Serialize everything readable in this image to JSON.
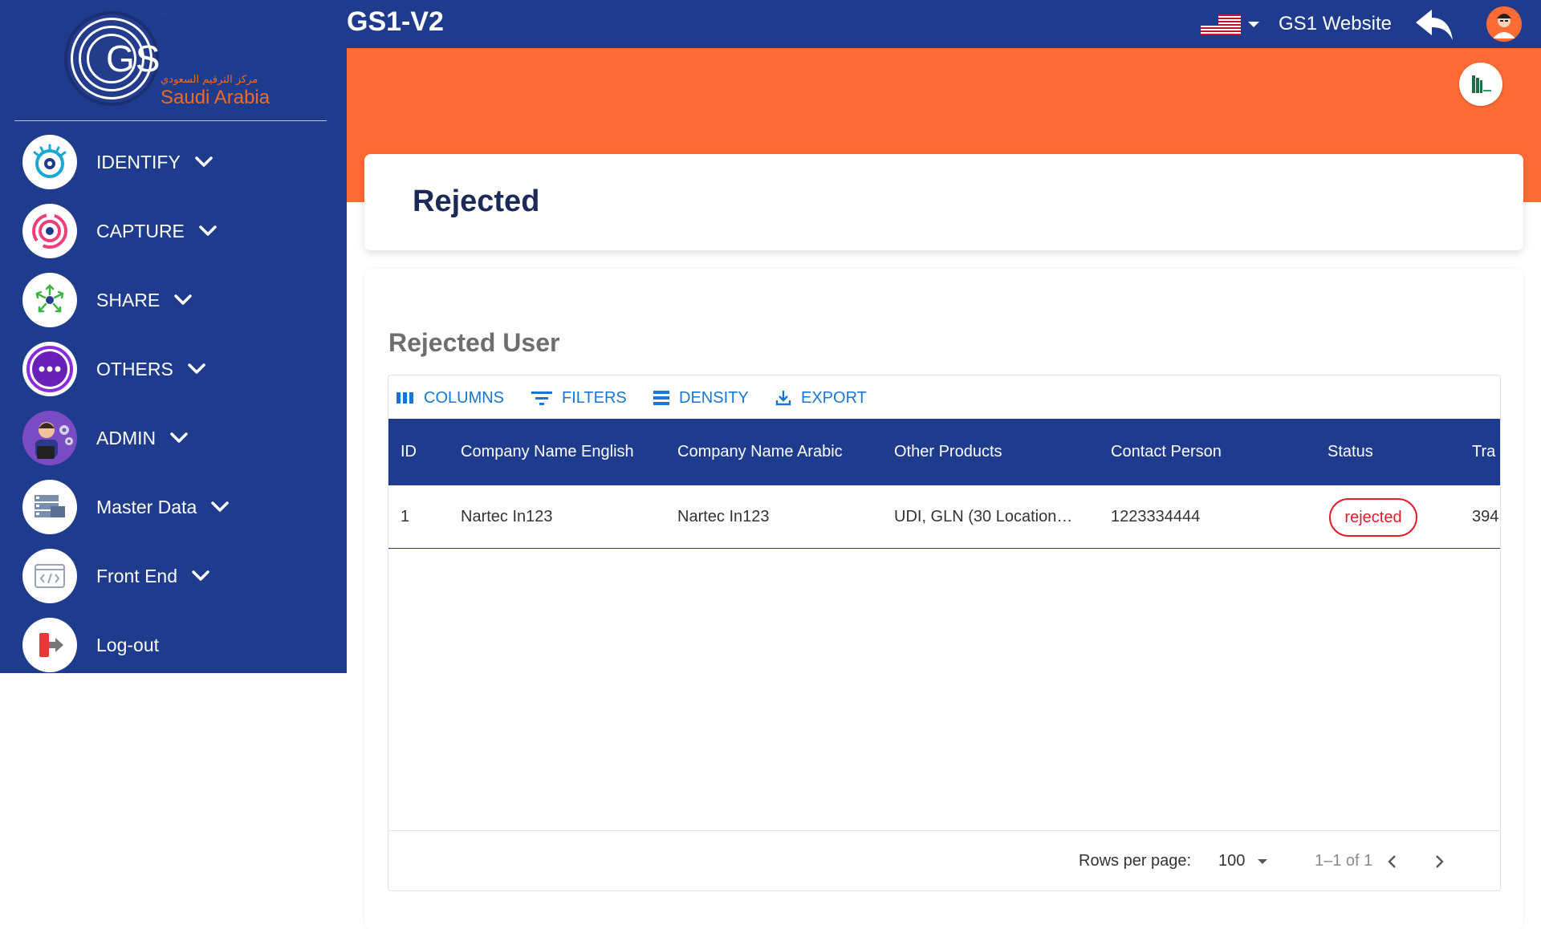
{
  "app": {
    "title": "GS1-V2",
    "website_link": "GS1 Website",
    "language_flag": "us-flag-icon"
  },
  "logo": {
    "letters": "GS",
    "arabic_text": "مركز الترقيم السعودي",
    "country": "Saudi Arabia"
  },
  "sidebar": {
    "items": [
      {
        "label": "IDENTIFY",
        "icon": "eye-icon",
        "expandable": true
      },
      {
        "label": "CAPTURE",
        "icon": "radar-icon",
        "expandable": true
      },
      {
        "label": "SHARE",
        "icon": "share-network-icon",
        "expandable": true
      },
      {
        "label": "OTHERS",
        "icon": "more-dots-icon",
        "expandable": true
      },
      {
        "label": "ADMIN",
        "icon": "admin-avatar-icon",
        "expandable": true
      },
      {
        "label": "Master Data",
        "icon": "master-data-icon",
        "expandable": true
      },
      {
        "label": "Front End",
        "icon": "code-window-icon",
        "expandable": true
      },
      {
        "label": "Log-out",
        "icon": "logout-door-icon",
        "expandable": false
      }
    ]
  },
  "page": {
    "title": "Rejected",
    "section_title": "Rejected User"
  },
  "toolbar": {
    "columns": "COLUMNS",
    "filters": "FILTERS",
    "density": "DENSITY",
    "export": "EXPORT"
  },
  "table": {
    "columns": [
      "ID",
      "Company Name English",
      "Company Name Arabic",
      "Other Products",
      "Contact Person",
      "Status",
      "Tra"
    ],
    "rows": [
      {
        "id": "1",
        "company_name_english": "Nartec In123",
        "company_name_arabic": "Nartec In123",
        "other_products": "UDI, GLN (30 Location…",
        "contact_person": "1223334444",
        "status": "rejected",
        "tra": "394"
      }
    ]
  },
  "pagination": {
    "rows_per_page_label": "Rows per page:",
    "rows_per_page": "100",
    "range": "1–1 of 1"
  },
  "colors": {
    "primary_navy": "#1f3b8d",
    "accent_orange": "#ff6b35",
    "link_blue": "#1976d2",
    "status_red": "#e11d2d"
  }
}
